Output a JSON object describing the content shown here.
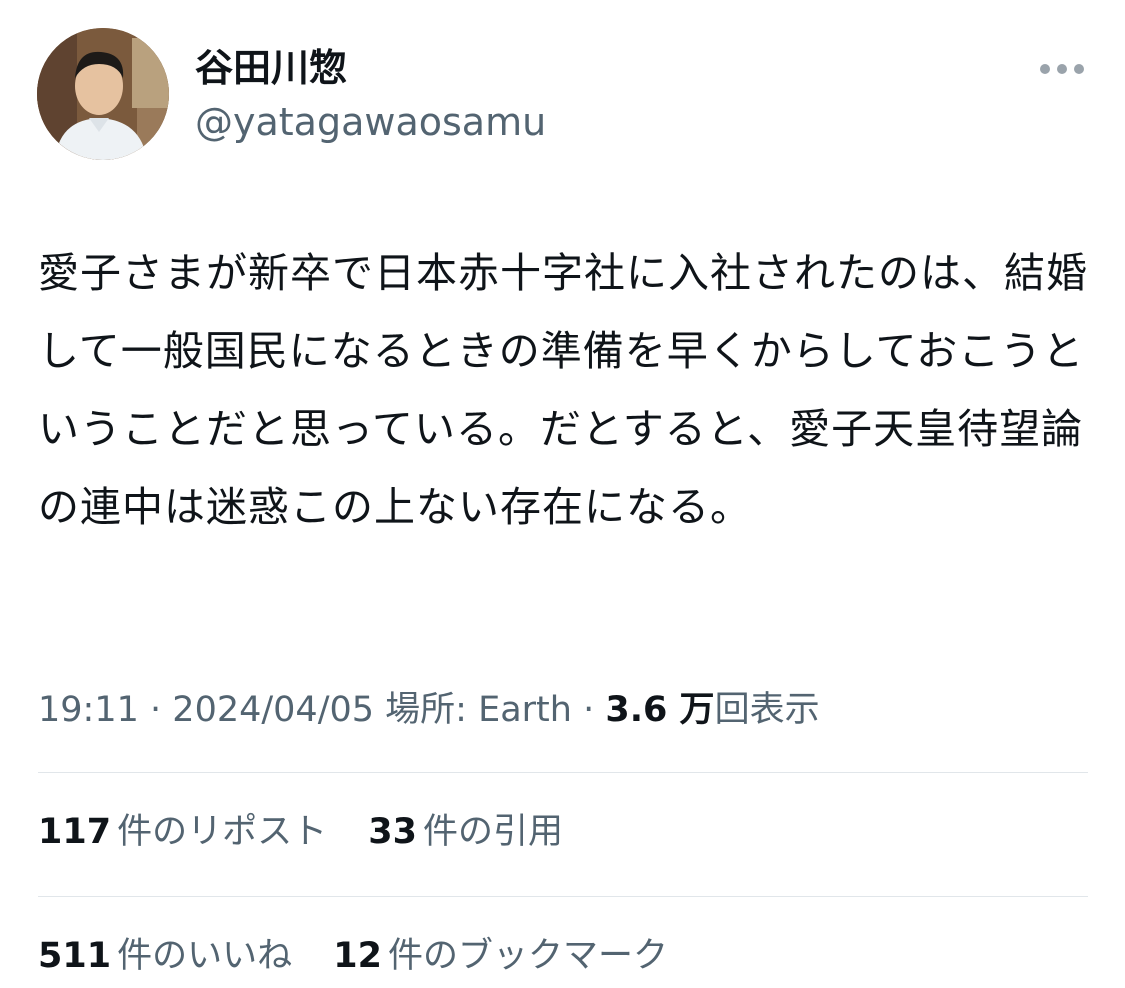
{
  "user": {
    "display_name": "谷田川惣",
    "handle": "@yatagawaosamu"
  },
  "tweet": {
    "text": "愛子さまが新卒で日本赤十字社に入社されたのは、結婚して一般国民になるときの準備を早くからしておこうということだと思っている。だとすると、愛子天皇待望論の連中は迷惑この上ない存在になる。"
  },
  "meta": {
    "time": "19:11",
    "separator1": "·",
    "date": "2024/04/05",
    "location_label": "場所: Earth",
    "separator2": "·",
    "views_count": "3.6 万",
    "views_label": "回表示"
  },
  "stats": {
    "reposts": {
      "count": "117",
      "label": "件のリポスト"
    },
    "quotes": {
      "count": "33",
      "label": "件の引用"
    },
    "likes": {
      "count": "511",
      "label": "件のいいね"
    },
    "bookmarks": {
      "count": "12",
      "label": "件のブックマーク"
    }
  },
  "icons": {
    "more": "more-horizontal-icon"
  }
}
